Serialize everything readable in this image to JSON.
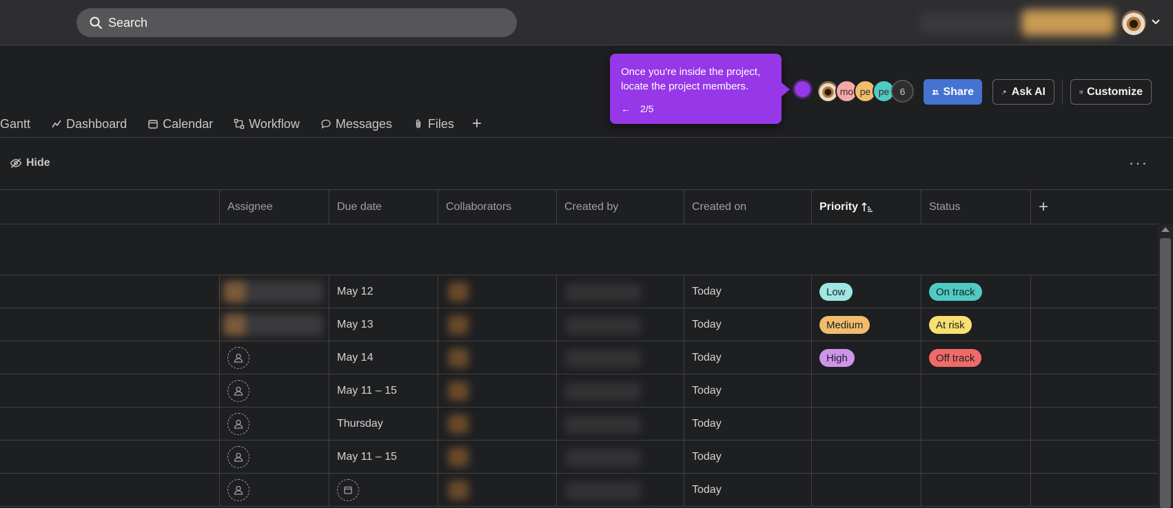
{
  "topbar": {
    "search_placeholder": "Search"
  },
  "tabs": [
    {
      "label": "Gantt",
      "icon": "none"
    },
    {
      "label": "Dashboard",
      "icon": "chart-line-icon"
    },
    {
      "label": "Calendar",
      "icon": "calendar-icon"
    },
    {
      "label": "Workflow",
      "icon": "workflow-icon"
    },
    {
      "label": "Messages",
      "icon": "message-icon"
    },
    {
      "label": "Files",
      "icon": "paperclip-icon"
    }
  ],
  "members": {
    "initials": [
      "mo",
      "pe",
      "pe"
    ],
    "count": "6"
  },
  "header_buttons": {
    "share": "Share",
    "ask_ai": "Ask AI",
    "customize": "Customize"
  },
  "tooltip": {
    "text": "Once you're inside the project, locate the project members.",
    "step": "2/5"
  },
  "toolbar": {
    "hide": "Hide",
    "more": "···"
  },
  "columns": [
    "Assignee",
    "Due date",
    "Collaborators",
    "Created by",
    "Created on",
    "Priority",
    "Status"
  ],
  "rows": [
    {
      "due": "May 12",
      "created_on": "Today",
      "priority": "Low",
      "status": "On track"
    },
    {
      "due": "May 13",
      "created_on": "Today",
      "priority": "Medium",
      "status": "At risk"
    },
    {
      "due": "May 14",
      "created_on": "Today",
      "priority": "High",
      "status": "Off track"
    },
    {
      "due": "May 11 – 15",
      "created_on": "Today",
      "priority": "",
      "status": ""
    },
    {
      "due": "Thursday",
      "created_on": "Today",
      "priority": "",
      "status": ""
    },
    {
      "due": "May 11 – 15",
      "created_on": "Today",
      "priority": "",
      "status": ""
    },
    {
      "due": "",
      "created_on": "Today",
      "priority": "",
      "status": ""
    }
  ],
  "colors": {
    "low": "#9ee7e3",
    "medium": "#f1bd6c",
    "high": "#cd95ea",
    "on_track": "#4ecbc4",
    "at_risk": "#f8df72",
    "off_track": "#f06a6a",
    "accent": "#9637e8",
    "share": "#4573d2"
  }
}
